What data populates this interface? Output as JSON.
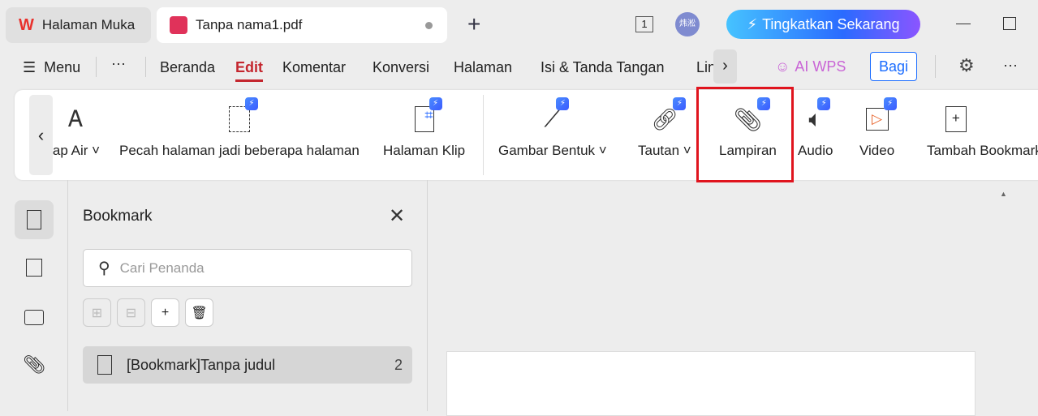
{
  "tabs": [
    {
      "label": "Halaman Muka"
    },
    {
      "label": "Tanpa nama1.pdf"
    }
  ],
  "titlebar": {
    "page_count": "1",
    "avatar": "炜淞",
    "upgrade": "Tingkatkan Sekarang"
  },
  "menu": {
    "menu_label": "Menu",
    "items": [
      "Beranda",
      "Edit",
      "Komentar",
      "Konversi",
      "Halaman",
      "Isi & Tanda Tangan",
      "Lindungi"
    ],
    "active": "Edit",
    "ai": "AI WPS",
    "share": "Bagi"
  },
  "toolbar": {
    "items": [
      {
        "label": "ap Air"
      },
      {
        "label": "Pecah halaman jadi beberapa halaman"
      },
      {
        "label": "Halaman Klip"
      },
      {
        "label": "Gambar Bentuk"
      },
      {
        "label": "Tautan"
      },
      {
        "label": "Lampiran"
      },
      {
        "label": "Audio"
      },
      {
        "label": "Video"
      },
      {
        "label": "Tambah Bookmark"
      }
    ]
  },
  "bookmark_panel": {
    "title": "Bookmark",
    "search_placeholder": "Cari Penanda",
    "items": [
      {
        "label": "[Bookmark]Tanpa judul",
        "page": "2"
      }
    ]
  },
  "colors": {
    "accent": "#c4262e",
    "highlight": "#e0141e",
    "share": "#1a6cff"
  }
}
